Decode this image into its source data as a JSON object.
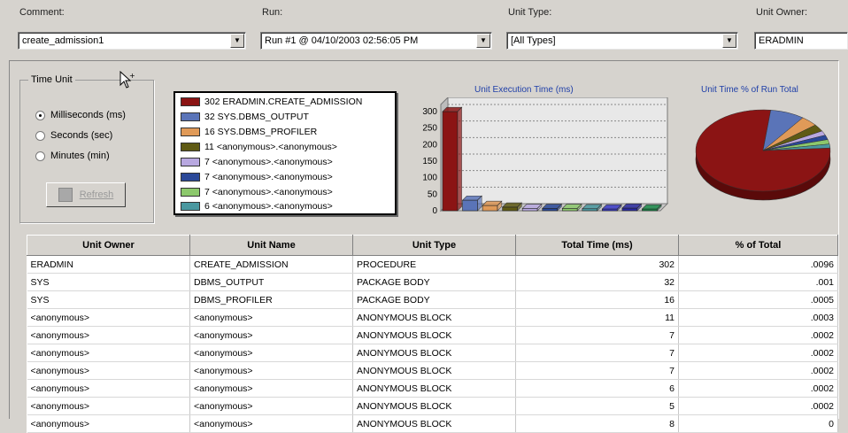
{
  "filters": {
    "comment_label": "Comment:",
    "comment_value": "create_admission1",
    "run_label": "Run:",
    "run_value": "Run #1 @ 04/10/2003 02:56:05 PM",
    "unit_type_label": "Unit Type:",
    "unit_type_value": "[All Types]",
    "unit_owner_label": "Unit Owner:",
    "unit_owner_value": "ERADMIN"
  },
  "time_unit": {
    "title": "Time Unit",
    "options": [
      "Milliseconds (ms)",
      "Seconds (sec)",
      "Minutes (min)"
    ],
    "selected_index": 0,
    "refresh_label": "Refresh"
  },
  "legend": [
    {
      "label": "302 ERADMIN.CREATE_ADMISSION",
      "color": "#8b1414"
    },
    {
      "label": "32 SYS.DBMS_OUTPUT",
      "color": "#5a74b8"
    },
    {
      "label": "16 SYS.DBMS_PROFILER",
      "color": "#e09a58"
    },
    {
      "label": "11 <anonymous>.<anonymous>",
      "color": "#5f5a14"
    },
    {
      "label": "7 <anonymous>.<anonymous>",
      "color": "#b8a8e0"
    },
    {
      "label": "7 <anonymous>.<anonymous>",
      "color": "#2a4898"
    },
    {
      "label": "7 <anonymous>.<anonymous>",
      "color": "#8cc86c"
    },
    {
      "label": "6 <anonymous>.<anonymous>",
      "color": "#4a98a0"
    }
  ],
  "chart_data": [
    {
      "type": "bar",
      "title": "Unit Execution Time (ms)",
      "categories": [
        "ERADMIN.CREATE_ADMISSION",
        "SYS.DBMS_OUTPUT",
        "SYS.DBMS_PROFILER",
        "<anonymous>.<anonymous>",
        "<anonymous>.<anonymous>",
        "<anonymous>.<anonymous>",
        "<anonymous>.<anonymous>",
        "<anonymous>.<anonymous>",
        "<anonymous>.<anonymous>",
        "<anonymous>.<anonymous>",
        "<anonymous>.<anonymous>"
      ],
      "values": [
        302,
        32,
        16,
        11,
        7,
        7,
        7,
        6,
        5,
        8,
        5
      ],
      "ylim": [
        0,
        300
      ],
      "yticks": [
        "300",
        "250",
        "200",
        "150",
        "100",
        "50",
        "0"
      ],
      "colors": [
        "#8b1414",
        "#5a74b8",
        "#e09a58",
        "#5f5a14",
        "#b8a8e0",
        "#2a4898",
        "#8cc86c",
        "#4a98a0",
        "#3a3ac8",
        "#2a2aa0",
        "#1a8a4a"
      ]
    },
    {
      "type": "pie",
      "title": "Unit Time % of Run Total",
      "values": [
        302,
        32,
        16,
        11,
        7,
        7,
        7,
        6
      ],
      "colors": [
        "#8b1414",
        "#5a74b8",
        "#e09a58",
        "#5f5a14",
        "#b8a8e0",
        "#2a4898",
        "#8cc86c",
        "#4a98a0"
      ]
    }
  ],
  "table": {
    "headers": [
      "Unit Owner",
      "Unit Name",
      "Unit Type",
      "Total Time (ms)",
      "% of Total"
    ],
    "rows": [
      [
        "ERADMIN",
        "CREATE_ADMISSION",
        "PROCEDURE",
        "302",
        ".0096"
      ],
      [
        "SYS",
        "DBMS_OUTPUT",
        "PACKAGE BODY",
        "32",
        ".001"
      ],
      [
        "SYS",
        "DBMS_PROFILER",
        "PACKAGE BODY",
        "16",
        ".0005"
      ],
      [
        "<anonymous>",
        "<anonymous>",
        "ANONYMOUS BLOCK",
        "11",
        ".0003"
      ],
      [
        "<anonymous>",
        "<anonymous>",
        "ANONYMOUS BLOCK",
        "7",
        ".0002"
      ],
      [
        "<anonymous>",
        "<anonymous>",
        "ANONYMOUS BLOCK",
        "7",
        ".0002"
      ],
      [
        "<anonymous>",
        "<anonymous>",
        "ANONYMOUS BLOCK",
        "7",
        ".0002"
      ],
      [
        "<anonymous>",
        "<anonymous>",
        "ANONYMOUS BLOCK",
        "6",
        ".0002"
      ],
      [
        "<anonymous>",
        "<anonymous>",
        "ANONYMOUS BLOCK",
        "5",
        ".0002"
      ],
      [
        "<anonymous>",
        "<anonymous>",
        "ANONYMOUS BLOCK",
        "8",
        "0"
      ]
    ]
  }
}
